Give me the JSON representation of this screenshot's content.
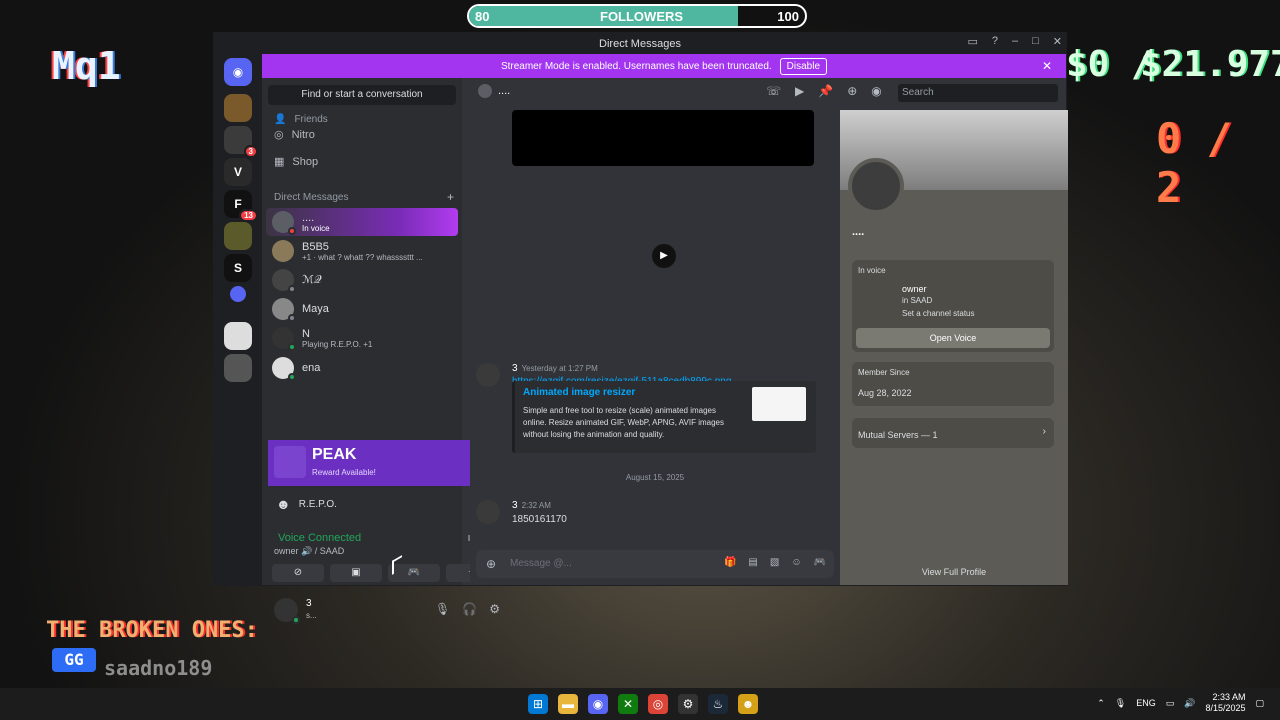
{
  "overlay": {
    "followers_label": "FOLLOWERS",
    "followers_current": "80",
    "followers_goal": "100",
    "followers_progress": 0.8,
    "left_text": "Mq1",
    "right_text_a": "$0 /",
    "right_text_b": "$21.977",
    "score": "0 / 2",
    "broken_label": "THE BROKEN ONES:",
    "broken_name": "saadno189",
    "broken_logo": "GG"
  },
  "window": {
    "title": "Direct Messages"
  },
  "banner": {
    "text": "Streamer Mode is enabled. Usernames have been truncated.",
    "button": "Disable"
  },
  "guilds": {
    "badges": [
      "3",
      "13"
    ]
  },
  "sidebar": {
    "search": "Find or start a conversation",
    "friends": "Friends",
    "nitro": "Nitro",
    "shop": "Shop",
    "dm_header": "Direct Messages",
    "dms": [
      {
        "name": "....",
        "sub": "In voice"
      },
      {
        "name": "B5B5",
        "sub": "+1 · what ? whatt ?? whassssttt ..."
      },
      {
        "name": "ℳ𝒬",
        "sub": ""
      },
      {
        "name": "Maya",
        "sub": ""
      },
      {
        "name": "N",
        "sub": "Playing R.E.P.O. +1"
      },
      {
        "name": "ena",
        "sub": ""
      }
    ]
  },
  "peak": {
    "title": "PEAK",
    "sub": "Reward Available!"
  },
  "repo": {
    "label": "R.E.P.O."
  },
  "voice": {
    "title": "Voice Connected",
    "sub": "owner 🔊 / SAAD"
  },
  "user": {
    "name": "3",
    "sub": "s..."
  },
  "chat": {
    "header": "....",
    "msg1_name": "3",
    "msg1_time": "Yesterday at 1:27 PM",
    "msg1_link": "https://ezgif.com/resize/ezgif-511a8cedb899c.png",
    "embed_title": "Animated image resizer",
    "embed_desc": "Simple and free tool to resize (scale) animated images online. Resize animated GIF, WebP, APNG, AVIF images without losing the animation and quality.",
    "date_divider": "August 15, 2025",
    "msg2_name": "3",
    "msg2_time": "2:32 AM",
    "msg2_text": "1850161170",
    "composer_placeholder": "Message @...",
    "search_placeholder": "Search"
  },
  "profile": {
    "name": "....",
    "in_voice": "In voice",
    "owner": "owner",
    "in_saad": "in SAAD",
    "channel_status": "Set a channel status",
    "open_voice": "Open Voice",
    "member_since_label": "Member Since",
    "member_since": "Aug 28, 2022",
    "mutual_servers": "Mutual Servers — 1",
    "view_full": "View Full Profile"
  },
  "taskbar": {
    "lang": "ENG",
    "time": "2:33 AM",
    "date": "8/15/2025"
  }
}
